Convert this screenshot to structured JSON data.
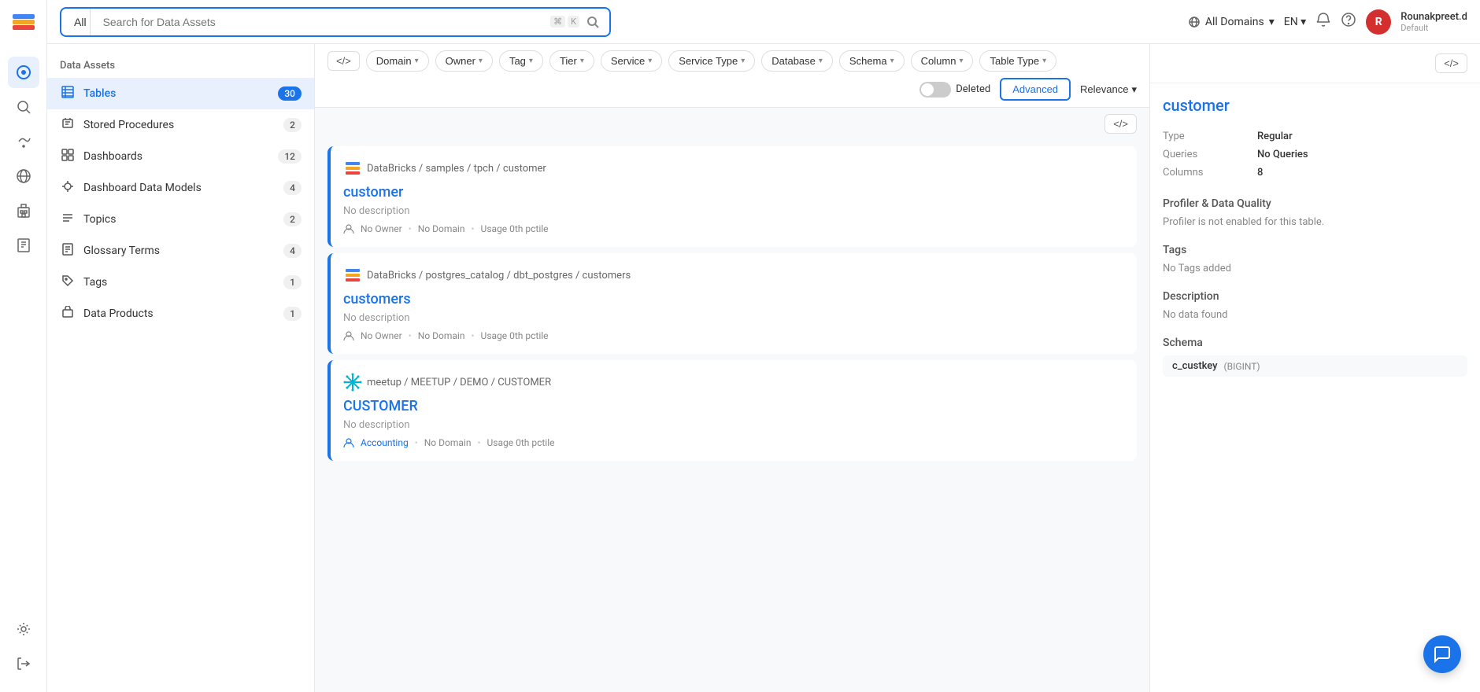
{
  "app": {
    "logo": "🗂️"
  },
  "header": {
    "search_placeholder": "Search for Data Assets",
    "all_label": "All",
    "kbd1": "⌘",
    "kbd2": "K",
    "domain_label": "All Domains",
    "lang_label": "EN",
    "user_name": "Rounakpreet.d",
    "user_role": "Default",
    "user_initial": "R"
  },
  "left_nav": {
    "section_title": "Data Assets",
    "items": [
      {
        "id": "tables",
        "label": "Tables",
        "icon": "▦",
        "count": 30,
        "active": true
      },
      {
        "id": "stored-procedures",
        "label": "Stored Procedures",
        "icon": "⚙",
        "count": 2,
        "active": false
      },
      {
        "id": "dashboards",
        "label": "Dashboards",
        "icon": "▦",
        "count": 12,
        "active": false
      },
      {
        "id": "dashboard-data-models",
        "label": "Dashboard Data Models",
        "icon": "✦",
        "count": 4,
        "active": false
      },
      {
        "id": "topics",
        "label": "Topics",
        "icon": "☰",
        "count": 2,
        "active": false
      },
      {
        "id": "glossary-terms",
        "label": "Glossary Terms",
        "icon": "📄",
        "count": 4,
        "active": false
      },
      {
        "id": "tags",
        "label": "Tags",
        "icon": "🏷",
        "count": 1,
        "active": false
      },
      {
        "id": "data-products",
        "label": "Data Products",
        "icon": "📦",
        "count": 1,
        "active": false
      }
    ]
  },
  "filter_bar": {
    "code_toggle": "</>",
    "filters": [
      {
        "id": "domain",
        "label": "Domain"
      },
      {
        "id": "owner",
        "label": "Owner"
      },
      {
        "id": "tag",
        "label": "Tag"
      },
      {
        "id": "tier",
        "label": "Tier"
      },
      {
        "id": "service",
        "label": "Service"
      },
      {
        "id": "service-type",
        "label": "Service Type"
      },
      {
        "id": "database",
        "label": "Database"
      },
      {
        "id": "schema",
        "label": "Schema"
      },
      {
        "id": "column",
        "label": "Column"
      },
      {
        "id": "table-type",
        "label": "Table Type"
      }
    ],
    "deleted_label": "Deleted",
    "advanced_label": "Advanced",
    "relevance_label": "Relevance"
  },
  "results": [
    {
      "id": "customer",
      "source": "DataBricks",
      "path": "DataBricks / samples / tpch / customer",
      "title": "customer",
      "description": "No description",
      "owner": "No Owner",
      "domain": "No Domain",
      "usage": "Usage 0th pctile"
    },
    {
      "id": "customers",
      "source": "DataBricks",
      "path": "DataBricks / postgres_catalog / dbt_postgres / customers",
      "title": "customers",
      "description": "No description",
      "owner": "No Owner",
      "domain": "No Domain",
      "usage": "Usage 0th pctile"
    },
    {
      "id": "CUSTOMER",
      "source": "meetup",
      "path": "meetup / MEETUP / DEMO / CUSTOMER",
      "title": "CUSTOMER",
      "description": "No description",
      "owner": "Accounting",
      "owner_link": true,
      "domain": "No Domain",
      "usage": "Usage 0th pctile"
    }
  ],
  "detail_panel": {
    "title": "customer",
    "type_label": "Type",
    "type_value": "Regular",
    "queries_label": "Queries",
    "queries_value": "No Queries",
    "columns_label": "Columns",
    "columns_value": "8",
    "profiler_section": "Profiler & Data Quality",
    "profiler_text": "Profiler is not enabled for this table.",
    "tags_section": "Tags",
    "tags_text": "No Tags added",
    "description_section": "Description",
    "description_text": "No data found",
    "schema_section": "Schema",
    "schema_fields": [
      {
        "name": "c_custkey",
        "type": "BIGINT"
      }
    ]
  },
  "icons": {
    "search": "🔍",
    "globe": "🌐",
    "bell": "🔔",
    "help": "❓",
    "chevron_down": "▾",
    "code": "</>",
    "chat": "💬"
  }
}
